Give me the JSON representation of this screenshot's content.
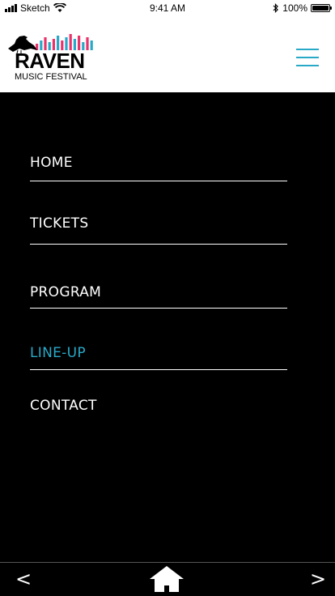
{
  "status_bar": {
    "carrier": "Sketch",
    "time": "9:41 AM",
    "battery_percent": "100%"
  },
  "header": {
    "logo": {
      "name": "RAVEN",
      "subtitle": "MUSIC FESTIVAL",
      "bar_colors": [
        "#e8336b",
        "#29a9c8"
      ]
    },
    "menu_icon": "hamburger-icon",
    "accent_color": "#29a9c8"
  },
  "nav": {
    "items": [
      {
        "label": "HOME",
        "active": false
      },
      {
        "label": "TICKETS",
        "active": false
      },
      {
        "label": "PROGRAM",
        "active": false
      },
      {
        "label": "LINE-UP",
        "active": true
      },
      {
        "label": "CONTACT",
        "active": false
      }
    ],
    "active_color": "#29a9c8",
    "text_color": "#ffffff"
  },
  "bottom_bar": {
    "prev_label": "<",
    "next_label": ">",
    "home_icon": "home-icon"
  }
}
